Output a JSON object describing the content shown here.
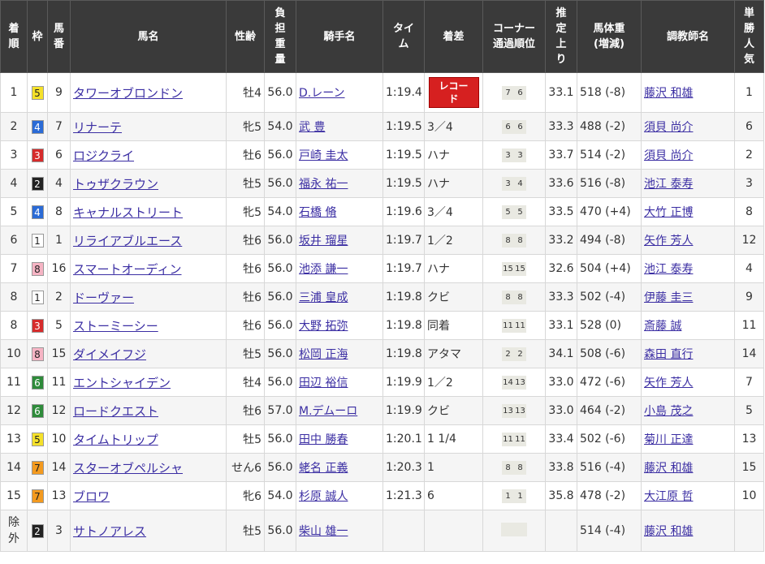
{
  "headers": {
    "rank": [
      "着",
      "順"
    ],
    "waku": [
      "枠"
    ],
    "num": [
      "馬",
      "番"
    ],
    "name": "馬名",
    "sex_age": "性齢",
    "weight": [
      "負",
      "担",
      "重",
      "量"
    ],
    "jockey": "騎手名",
    "time": [
      "タイ",
      "ム"
    ],
    "margin": "着差",
    "corner": [
      "コーナー",
      "通過順位"
    ],
    "last": [
      "推",
      "定",
      "上",
      "り"
    ],
    "body_weight": [
      "馬体重",
      "(増減)"
    ],
    "trainer": "調教師名",
    "pop": [
      "単",
      "勝",
      "人",
      "気"
    ]
  },
  "colors": {
    "waku_1": "#ffffff",
    "waku_2": "#222222",
    "waku_3": "#d62b2b",
    "waku_4": "#2b6bd6",
    "waku_5": "#f5e12a",
    "waku_6": "#2e8b3a",
    "waku_7": "#f39a1f",
    "waku_8": "#f6b4c4",
    "record": "#d62020",
    "link": "#3b2ea3"
  },
  "rows": [
    {
      "rank": "1",
      "waku": "5",
      "num": "9",
      "name": "タワーオブロンドン",
      "sex_age": "牡4",
      "weight": "56.0",
      "jockey": "D.レーン",
      "time": "1:19.4",
      "margin": "",
      "record": [
        "レコー",
        "ド"
      ],
      "corner": [
        "7",
        "6"
      ],
      "last": "33.1",
      "body": "518 (-8)",
      "trainer": "藤沢 和雄",
      "pop": "1"
    },
    {
      "rank": "2",
      "waku": "4",
      "num": "7",
      "name": "リナーテ",
      "sex_age": "牝5",
      "weight": "54.0",
      "jockey": "武 豊",
      "time": "1:19.5",
      "margin": "3／4",
      "corner": [
        "6",
        "6"
      ],
      "last": "33.3",
      "body": "488 (-2)",
      "trainer": "須貝 尚介",
      "pop": "6"
    },
    {
      "rank": "3",
      "waku": "3",
      "num": "6",
      "name": "ロジクライ",
      "sex_age": "牡6",
      "weight": "56.0",
      "jockey": "戸崎 圭太",
      "time": "1:19.5",
      "margin": "ハナ",
      "corner": [
        "3",
        "3"
      ],
      "last": "33.7",
      "body": "514 (-2)",
      "trainer": "須貝 尚介",
      "pop": "2"
    },
    {
      "rank": "4",
      "waku": "2",
      "num": "4",
      "name": "トゥザクラウン",
      "sex_age": "牡5",
      "weight": "56.0",
      "jockey": "福永 祐一",
      "time": "1:19.5",
      "margin": "ハナ",
      "corner": [
        "3",
        "4"
      ],
      "last": "33.6",
      "body": "516 (-8)",
      "trainer": "池江 泰寿",
      "pop": "3"
    },
    {
      "rank": "5",
      "waku": "4",
      "num": "8",
      "name": "キャナルストリート",
      "sex_age": "牝5",
      "weight": "54.0",
      "jockey": "石橋 脩",
      "time": "1:19.6",
      "margin": "3／4",
      "corner": [
        "5",
        "5"
      ],
      "last": "33.5",
      "body": "470 (+4)",
      "trainer": "大竹 正博",
      "pop": "8"
    },
    {
      "rank": "6",
      "waku": "1",
      "num": "1",
      "name": "リライアブルエース",
      "sex_age": "牡6",
      "weight": "56.0",
      "jockey": "坂井 瑠星",
      "time": "1:19.7",
      "margin": "1／2",
      "corner": [
        "8",
        "8"
      ],
      "last": "33.2",
      "body": "494 (-8)",
      "trainer": "矢作 芳人",
      "pop": "12"
    },
    {
      "rank": "7",
      "waku": "8",
      "num": "16",
      "name": "スマートオーディン",
      "sex_age": "牡6",
      "weight": "56.0",
      "jockey": "池添 謙一",
      "time": "1:19.7",
      "margin": "ハナ",
      "corner": [
        "15",
        "15"
      ],
      "last": "32.6",
      "body": "504 (+4)",
      "trainer": "池江 泰寿",
      "pop": "4"
    },
    {
      "rank": "8",
      "waku": "1",
      "num": "2",
      "name": "ドーヴァー",
      "sex_age": "牡6",
      "weight": "56.0",
      "jockey": "三浦 皇成",
      "time": "1:19.8",
      "margin": "クビ",
      "corner": [
        "8",
        "8"
      ],
      "last": "33.3",
      "body": "502 (-4)",
      "trainer": "伊藤 圭三",
      "pop": "9"
    },
    {
      "rank": "8",
      "waku": "3",
      "num": "5",
      "name": "ストーミーシー",
      "sex_age": "牡6",
      "weight": "56.0",
      "jockey": "大野 拓弥",
      "time": "1:19.8",
      "margin": "同着",
      "corner": [
        "11",
        "11"
      ],
      "last": "33.1",
      "body": "528 (0)",
      "trainer": "斎藤 誠",
      "pop": "11"
    },
    {
      "rank": "10",
      "waku": "8",
      "num": "15",
      "name": "ダイメイフジ",
      "sex_age": "牡5",
      "weight": "56.0",
      "jockey": "松岡 正海",
      "time": "1:19.8",
      "margin": "アタマ",
      "corner": [
        "2",
        "2"
      ],
      "last": "34.1",
      "body": "508 (-6)",
      "trainer": "森田 直行",
      "pop": "14"
    },
    {
      "rank": "11",
      "waku": "6",
      "num": "11",
      "name": "エントシャイデン",
      "sex_age": "牡4",
      "weight": "56.0",
      "jockey": "田辺 裕信",
      "time": "1:19.9",
      "margin": "1／2",
      "corner": [
        "14",
        "13"
      ],
      "last": "33.0",
      "body": "472 (-6)",
      "trainer": "矢作 芳人",
      "pop": "7"
    },
    {
      "rank": "12",
      "waku": "6",
      "num": "12",
      "name": "ロードクエスト",
      "sex_age": "牡6",
      "weight": "57.0",
      "jockey": "M.デムーロ",
      "time": "1:19.9",
      "margin": "クビ",
      "corner": [
        "13",
        "13"
      ],
      "last": "33.0",
      "body": "464 (-2)",
      "trainer": "小島 茂之",
      "pop": "5"
    },
    {
      "rank": "13",
      "waku": "5",
      "num": "10",
      "name": "タイムトリップ",
      "sex_age": "牡5",
      "weight": "56.0",
      "jockey": "田中 勝春",
      "time": "1:20.1",
      "margin": "1 1/4",
      "corner": [
        "11",
        "11"
      ],
      "last": "33.4",
      "body": "502 (-6)",
      "trainer": "菊川 正達",
      "pop": "13"
    },
    {
      "rank": "14",
      "waku": "7",
      "num": "14",
      "name": "スターオブペルシャ",
      "sex_age": "せん6",
      "weight": "56.0",
      "jockey": "蛯名 正義",
      "time": "1:20.3",
      "margin": "1",
      "corner": [
        "8",
        "8"
      ],
      "last": "33.8",
      "body": "516 (-4)",
      "trainer": "藤沢 和雄",
      "pop": "15"
    },
    {
      "rank": "15",
      "waku": "7",
      "num": "13",
      "name": "ブロワ",
      "sex_age": "牝6",
      "weight": "54.0",
      "jockey": "杉原 誠人",
      "time": "1:21.3",
      "margin": "6",
      "corner": [
        "1",
        "1"
      ],
      "last": "35.8",
      "body": "478 (-2)",
      "trainer": "大江原 哲",
      "pop": "10"
    },
    {
      "rank": "除外",
      "waku": "2",
      "num": "3",
      "name": "サトノアレス",
      "sex_age": "牡5",
      "weight": "56.0",
      "jockey": "柴山 雄一",
      "time": "",
      "margin": "",
      "corner": [
        "",
        ""
      ],
      "last": "",
      "body": "514 (-4)",
      "trainer": "藤沢 和雄",
      "pop": ""
    }
  ]
}
